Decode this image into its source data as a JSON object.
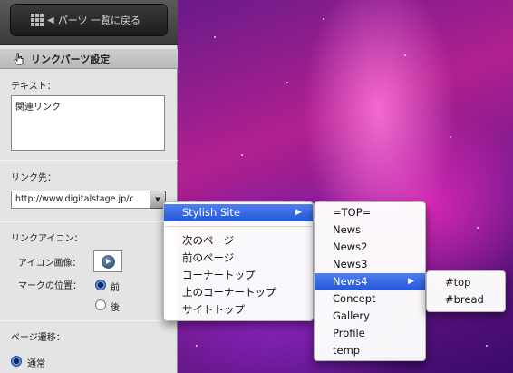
{
  "topbar": {
    "back_label": "パーツ 一覧に戻る"
  },
  "section": {
    "title": "リンクパーツ設定"
  },
  "text_field": {
    "label": "テキスト：",
    "value": "関連リンク"
  },
  "link": {
    "label": "リンク先：",
    "url": "http://www.digitalstage.jp/c"
  },
  "link_icon": {
    "label": "リンクアイコン：",
    "image_label": "アイコン画像：",
    "mark_label": "マークの位置：",
    "options": [
      "前",
      "後"
    ],
    "selected": "前"
  },
  "transition": {
    "label": "ページ遷移：",
    "option": "通常"
  },
  "menu1": {
    "items": [
      {
        "label": "Stylish Site",
        "submenu": true,
        "selected": true
      },
      {
        "label": "次のページ"
      },
      {
        "label": "前のページ"
      },
      {
        "label": "コーナートップ"
      },
      {
        "label": "上のコーナートップ"
      },
      {
        "label": "サイトトップ"
      }
    ]
  },
  "menu2": {
    "items": [
      {
        "label": "=TOP="
      },
      {
        "label": "News"
      },
      {
        "label": "News2"
      },
      {
        "label": "News3"
      },
      {
        "label": "News4",
        "submenu": true,
        "selected": true
      },
      {
        "label": "Concept"
      },
      {
        "label": "Gallery"
      },
      {
        "label": "Profile"
      },
      {
        "label": "temp"
      }
    ]
  },
  "menu3": {
    "items": [
      {
        "label": "#top"
      },
      {
        "label": "#bread"
      }
    ]
  }
}
